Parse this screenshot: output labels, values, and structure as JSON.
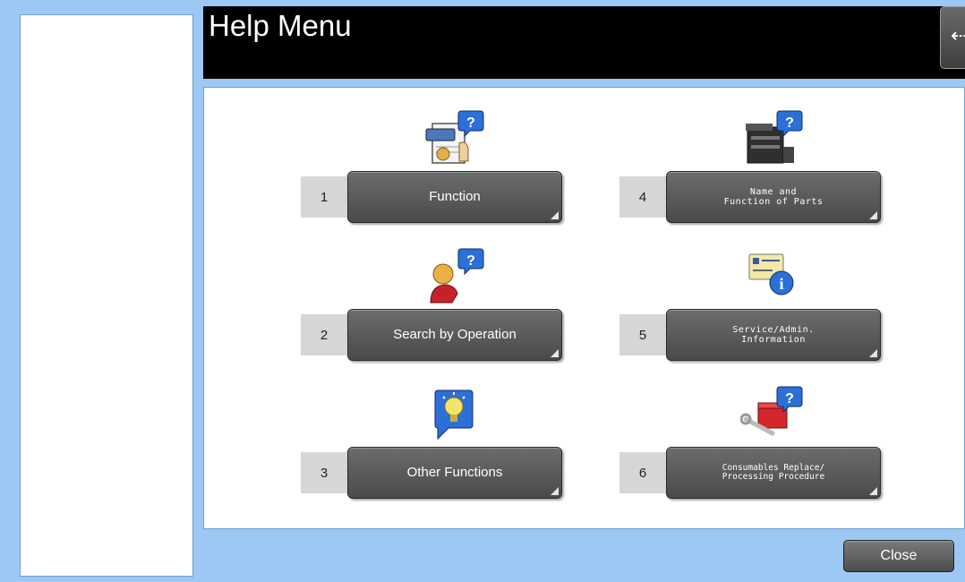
{
  "header": {
    "title": "Help Menu",
    "back_icon": "arrow-left-icon",
    "back_glyph": "⇠"
  },
  "menu": {
    "items": [
      {
        "number": "1",
        "label": "Function",
        "icon": "function-help-icon"
      },
      {
        "number": "2",
        "label": "Search by Operation",
        "icon": "operation-search-icon"
      },
      {
        "number": "3",
        "label": "Other Functions",
        "icon": "lightbulb-icon"
      },
      {
        "number": "4",
        "label": "Name and\nFunction of Parts",
        "icon": "printer-help-icon"
      },
      {
        "number": "5",
        "label": "Service/Admin.\nInformation",
        "icon": "info-card-icon"
      },
      {
        "number": "6",
        "label": "Consumables Replace/\nProcessing Procedure",
        "icon": "toolbox-help-icon"
      }
    ]
  },
  "footer": {
    "close_label": "Close"
  },
  "colors": {
    "background": "#9cc8f3",
    "header": "#000000",
    "button": "#5a5a5a"
  }
}
